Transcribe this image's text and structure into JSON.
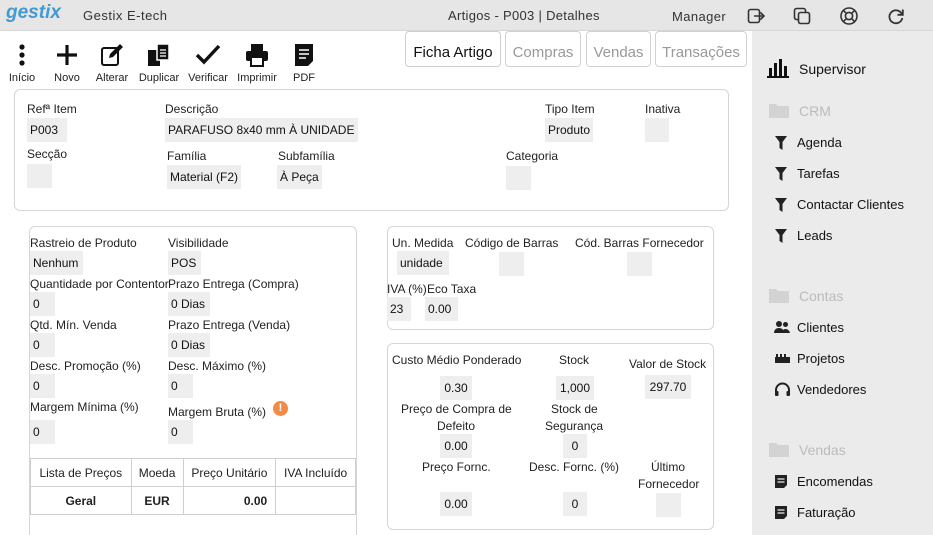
{
  "app": {
    "logo": "gestix",
    "company": "Gestix E-tech",
    "title": "Artigos - P003 | Detalhes",
    "user": "Manager"
  },
  "toolbar": {
    "inicio": "Início",
    "novo": "Novo",
    "alterar": "Alterar",
    "duplicar": "Duplicar",
    "verificar": "Verificar",
    "imprimir": "Imprimir",
    "pdf": "PDF"
  },
  "tabs": [
    "Ficha Artigo",
    "Compras",
    "Vendas",
    "Transações"
  ],
  "sidebar": {
    "supervisor": "Supervisor",
    "crm": "CRM",
    "agenda": "Agenda",
    "tarefas": "Tarefas",
    "contactar": "Contactar Clientes",
    "leads": "Leads",
    "contas": "Contas",
    "clientes": "Clientes",
    "projetos": "Projetos",
    "vendedores": "Vendedores",
    "vendas": "Vendas",
    "encomendas": "Encomendas",
    "faturacao": "Faturação"
  },
  "item": {
    "ref_label": "Refª Item",
    "ref": "P003",
    "desc_label": "Descrição",
    "desc": "PARAFUSO 8x40 mm À UNIDADE",
    "tipo_label": "Tipo Item",
    "tipo": "Produto",
    "inativa_label": "Inativa",
    "inativa": "",
    "seccao_label": "Secção",
    "seccao": "",
    "familia_label": "Família",
    "familia": "Material (F2)",
    "subfamilia_label": "Subfamília",
    "subfamilia": "À Peça",
    "categoria_label": "Categoria",
    "categoria": ""
  },
  "produto": {
    "rastreio_label": "Rastreio de Produto",
    "rastreio": "Nenhum",
    "visibilidade_label": "Visibilidade",
    "visibilidade": "POS",
    "qtd_contentor_label": "Quantidade por Contentor",
    "qtd_contentor": "0",
    "prazo_compra_label": "Prazo Entrega (Compra)",
    "prazo_compra": "0 Dias",
    "qtd_min_label": "Qtd. Mín. Venda",
    "qtd_min": "0",
    "prazo_venda_label": "Prazo Entrega (Venda)",
    "prazo_venda": "0 Dias",
    "desc_promo_label": "Desc. Promoção (%)",
    "desc_promo": "0",
    "desc_max_label": "Desc. Máximo (%)",
    "desc_max": "0",
    "margem_min_label": "Margem Mínima (%)",
    "margem_min": "0",
    "margem_bruta_label": "Margem Bruta (%)",
    "margem_bruta": "0",
    "warn": "!"
  },
  "precos": {
    "headers": [
      "Lista de Preços",
      "Moeda",
      "Preço Unitário",
      "IVA Incluído"
    ],
    "row": [
      "Geral",
      "EUR",
      "0.00",
      ""
    ]
  },
  "medida": {
    "un_label": "Un. Medida",
    "un": "unidade",
    "barras_label": "Código de Barras",
    "barras": "",
    "barras_forn_label": "Cód. Barras Fornecedor",
    "barras_forn": "",
    "iva_label": "IVA (%)",
    "iva": "23",
    "eco_label": "Eco Taxa",
    "eco": "0.00"
  },
  "stock": {
    "custo_label": "Custo Médio Ponderado",
    "custo": "0.30",
    "stock_label": "Stock",
    "stock": "1,000",
    "valor_label": "Valor de Stock",
    "valor": "297.70",
    "preco_compra_label_1": "Preço de Compra de",
    "preco_compra_label_2": "Defeito",
    "preco_compra": "0.00",
    "seguranca_label_1": "Stock de",
    "seguranca_label_2": "Segurança",
    "seguranca": "0",
    "preco_forn_label": "Preço Fornc.",
    "preco_forn": "0.00",
    "desc_forn_label": "Desc. Fornc. (%)",
    "desc_forn": "0",
    "ultimo_label_1": "Último",
    "ultimo_label_2": "Fornecedor",
    "ultimo": ""
  },
  "colors": {
    "logo": "#3f9bd1",
    "warn": "#f08c45",
    "sidebar": "#ebebeb",
    "topbar": "#e6e6e6"
  }
}
